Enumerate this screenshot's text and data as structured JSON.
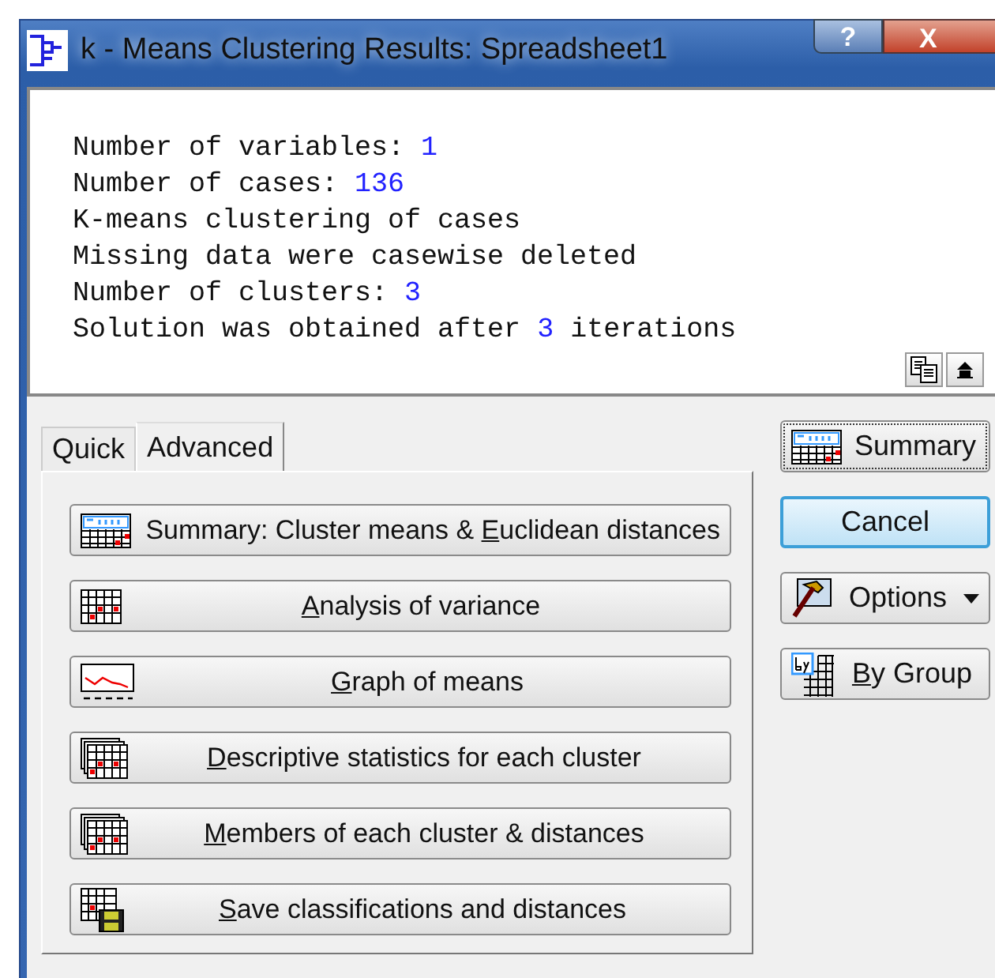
{
  "window": {
    "title": "k - Means Clustering Results: Spreadsheet1",
    "help_button": "?",
    "close_button": "X"
  },
  "output": {
    "lines": [
      {
        "parts": [
          {
            "text": "Number of variables: ",
            "kind": "label"
          },
          {
            "text": "1",
            "kind": "value"
          }
        ]
      },
      {
        "parts": [
          {
            "text": "Number of cases: ",
            "kind": "label"
          },
          {
            "text": "136",
            "kind": "value"
          }
        ]
      },
      {
        "parts": [
          {
            "text": "K-means clustering of cases",
            "kind": "label"
          }
        ]
      },
      {
        "parts": [
          {
            "text": "Missing data were casewise deleted",
            "kind": "label"
          }
        ]
      },
      {
        "parts": [
          {
            "text": "Number of clusters: ",
            "kind": "label"
          },
          {
            "text": "3",
            "kind": "value"
          }
        ]
      },
      {
        "parts": [
          {
            "text": "Solution was obtained after ",
            "kind": "label"
          },
          {
            "text": "3",
            "kind": "value"
          },
          {
            "text": " iterations",
            "kind": "label"
          }
        ]
      }
    ]
  },
  "tabs": [
    {
      "label": "Quick",
      "selected": false
    },
    {
      "label": "Advanced",
      "selected": true
    }
  ],
  "actions": [
    {
      "kind": "summary",
      "prefix": "Summary: Cluster means & ",
      "key": "E",
      "rest": "uclidean distances"
    },
    {
      "kind": "grid",
      "key": "A",
      "rest": "nalysis of variance"
    },
    {
      "kind": "graph",
      "key": "G",
      "rest": "raph of means"
    },
    {
      "kind": "stack",
      "key": "D",
      "rest": "escriptive statistics for each cluster"
    },
    {
      "kind": "stack",
      "key": "M",
      "rest": "embers of each cluster & distances"
    },
    {
      "kind": "save",
      "key": "S",
      "rest": "ave classifications and distances"
    }
  ],
  "side_buttons": [
    {
      "kind": "summary",
      "prefix": "Summary",
      "focused": true,
      "default": false,
      "dropdown": false
    },
    {
      "kind": "none",
      "prefix": "Cancel",
      "focused": false,
      "default": true,
      "dropdown": false
    },
    {
      "kind": "options",
      "prefix": "Options",
      "focused": false,
      "default": false,
      "dropdown": true
    },
    {
      "kind": "bygroup",
      "key": "B",
      "rest": "y Group",
      "focused": false,
      "default": false,
      "dropdown": false
    }
  ]
}
